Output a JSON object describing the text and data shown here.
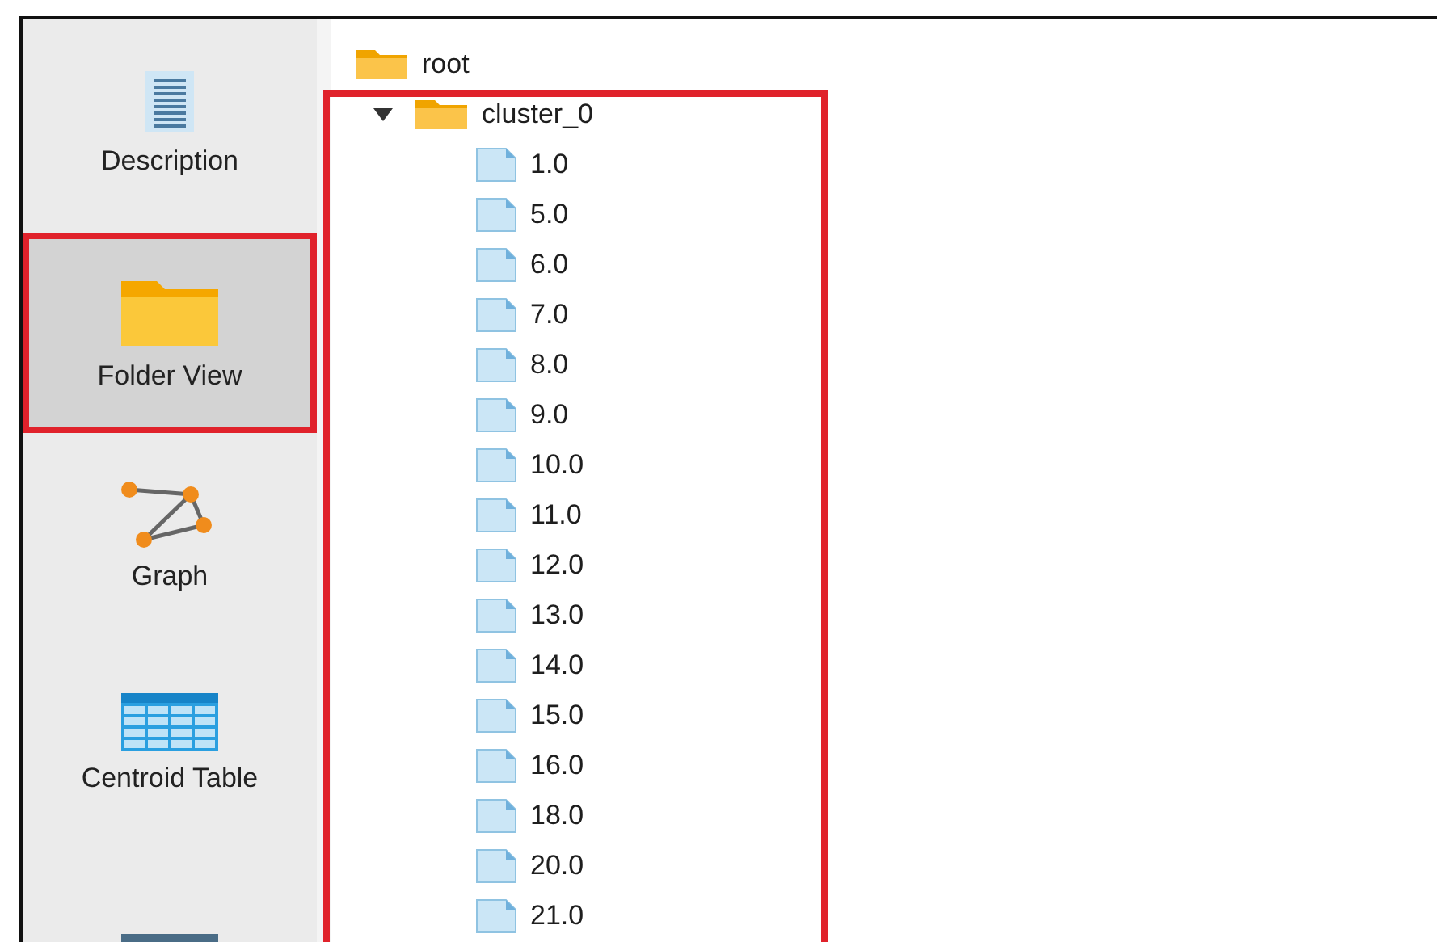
{
  "sidebar": {
    "items": [
      {
        "label": "Description",
        "kind": "document",
        "selected": false
      },
      {
        "label": "Folder View",
        "kind": "folder",
        "selected": true
      },
      {
        "label": "Graph",
        "kind": "graph",
        "selected": false
      },
      {
        "label": "Centroid Table",
        "kind": "table",
        "selected": false
      },
      {
        "kind": "chart",
        "selected": false
      }
    ]
  },
  "tree": {
    "items": [
      {
        "label": "root",
        "kind": "folder",
        "children": [
          {
            "label": "cluster_0",
            "kind": "folder",
            "expanded": true,
            "children": [
              {
                "label": "1.0",
                "kind": "file"
              },
              {
                "label": "5.0",
                "kind": "file"
              },
              {
                "label": "6.0",
                "kind": "file"
              },
              {
                "label": "7.0",
                "kind": "file"
              },
              {
                "label": "8.0",
                "kind": "file"
              },
              {
                "label": "9.0",
                "kind": "file"
              },
              {
                "label": "10.0",
                "kind": "file"
              },
              {
                "label": "11.0",
                "kind": "file"
              },
              {
                "label": "12.0",
                "kind": "file"
              },
              {
                "label": "13.0",
                "kind": "file"
              },
              {
                "label": "14.0",
                "kind": "file"
              },
              {
                "label": "15.0",
                "kind": "file"
              },
              {
                "label": "16.0",
                "kind": "file"
              },
              {
                "label": "18.0",
                "kind": "file"
              },
              {
                "label": "20.0",
                "kind": "file"
              },
              {
                "label": "21.0",
                "kind": "file"
              }
            ]
          }
        ]
      }
    ],
    "highlighted": true
  }
}
